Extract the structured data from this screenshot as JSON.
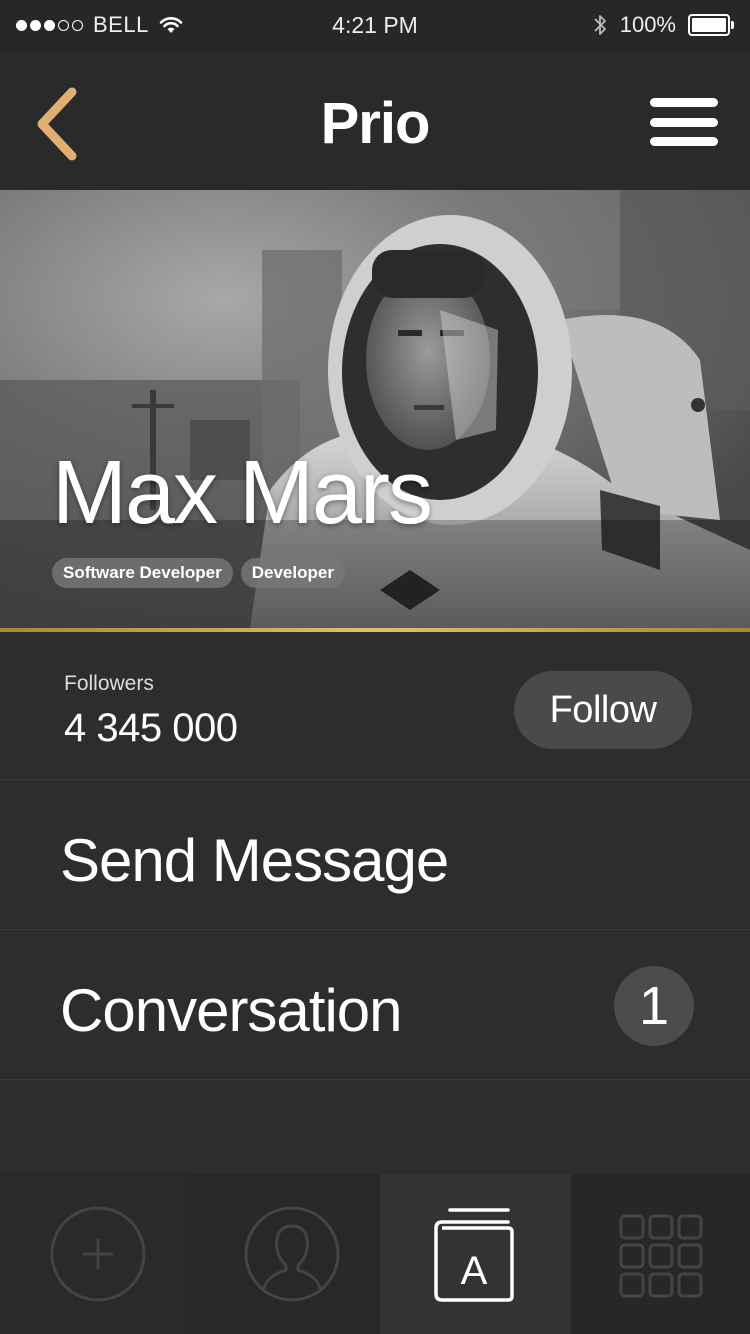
{
  "status_bar": {
    "carrier": "BELL",
    "time": "4:21 PM",
    "battery_percent": "100%",
    "signal_bars": 3,
    "signal_total": 5,
    "icons": [
      "wifi-icon",
      "bluetooth-icon",
      "battery-icon"
    ]
  },
  "nav": {
    "title": "Prio",
    "back_icon": "chevron-left-icon",
    "menu_icon": "hamburger-menu-icon",
    "accent_color": "#e0b070"
  },
  "profile": {
    "name": "Max Mars",
    "tags": [
      "Software Developer",
      "Developer"
    ],
    "followers_label": "Followers",
    "followers_count": "4 345 000",
    "follow_label": "Follow"
  },
  "actions": {
    "send_message": "Send Message",
    "conversation": "Conversation",
    "conversation_badge": "1"
  },
  "tabbar": {
    "items": [
      {
        "icon": "add-circle-icon",
        "active": false
      },
      {
        "icon": "user-profile-icon",
        "active": false
      },
      {
        "icon": "address-book-icon",
        "active": true,
        "glyph": "A"
      },
      {
        "icon": "grid-icon",
        "active": false
      }
    ]
  },
  "colors": {
    "background": "#2d2d2d",
    "gold_divider": "#d4b060",
    "badge": "#4c4c4c"
  }
}
